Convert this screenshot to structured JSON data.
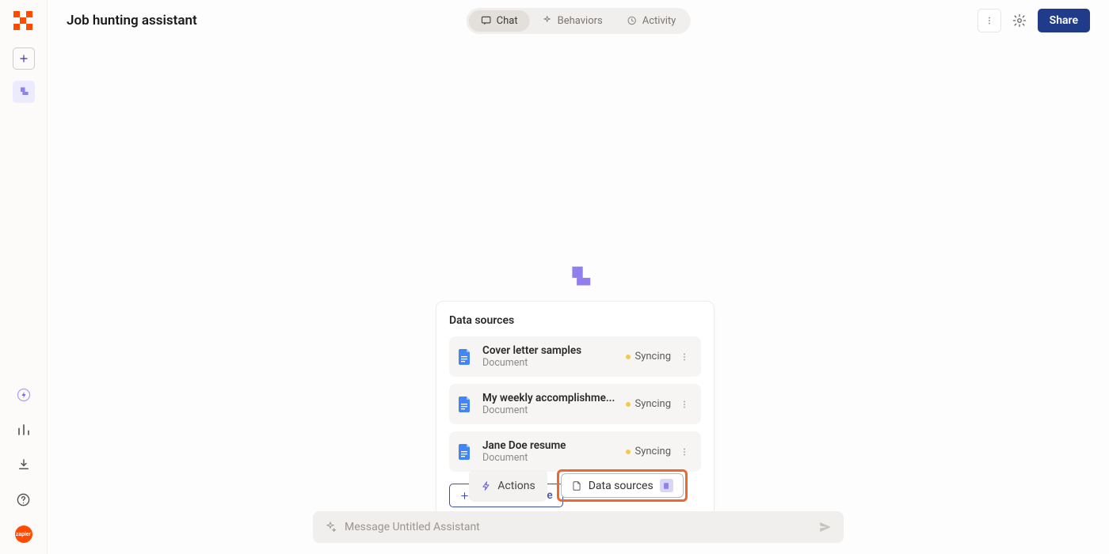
{
  "header": {
    "title": "Job hunting assistant",
    "tabs": [
      {
        "label": "Chat",
        "active": true
      },
      {
        "label": "Behaviors",
        "active": false
      },
      {
        "label": "Activity",
        "active": false
      }
    ],
    "share_label": "Share"
  },
  "panel": {
    "title": "Data sources",
    "items": [
      {
        "name": "Cover letter samples",
        "type": "Document",
        "status": "Syncing"
      },
      {
        "name": "My weekly accomplishme...",
        "type": "Document",
        "status": "Syncing"
      },
      {
        "name": "Jane Doe resume",
        "type": "Document",
        "status": "Syncing"
      }
    ],
    "add_label": "Add data source"
  },
  "bottom": {
    "actions_label": "Actions",
    "datasources_label": "Data sources",
    "input_placeholder": "Message Untitled Assistant"
  },
  "sidebar": {
    "badge_text": "zapier"
  }
}
